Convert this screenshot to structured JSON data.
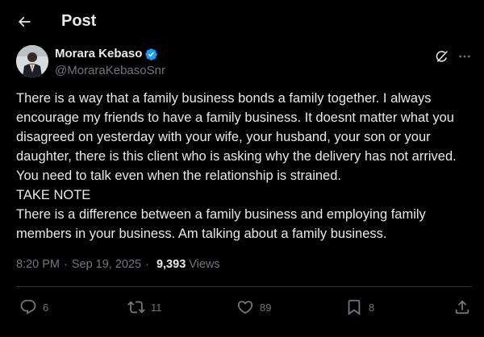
{
  "header": {
    "title": "Post"
  },
  "author": {
    "name": "Morara Kebaso",
    "handle": "@MoraraKebasoSnr",
    "verified": true
  },
  "tweet": {
    "lines": [
      "There is a way that a family business bonds a family together. I always encourage my friends to have a family business. It doesnt matter what you disagreed on yesterday with your wife, your husband, your son or your daughter, there is this client who is asking why the delivery has not arrived. You need to talk even when the relationship is strained.",
      "TAKE NOTE",
      "There is a difference between a family business and employing family members in your business. Am talking about a family business."
    ]
  },
  "meta": {
    "time": "8:20 PM",
    "separator": "·",
    "date": "Sep 19, 2025",
    "views_count": "9,393",
    "views_label": "Views"
  },
  "actions": {
    "replies": "6",
    "reposts": "11",
    "likes": "89",
    "bookmarks": "8"
  },
  "icons": {
    "back": "arrow-left-icon",
    "verified": "verified-badge-icon",
    "grok": "grok-icon",
    "more": "more-icon",
    "reply": "reply-icon",
    "repost": "repost-icon",
    "like": "heart-icon",
    "bookmark": "bookmark-icon",
    "share": "share-icon"
  },
  "colors": {
    "background": "#000000",
    "text": "#e7e9ea",
    "muted": "#71767b",
    "divider": "#2f3336",
    "verified": "#1d9bf0"
  }
}
